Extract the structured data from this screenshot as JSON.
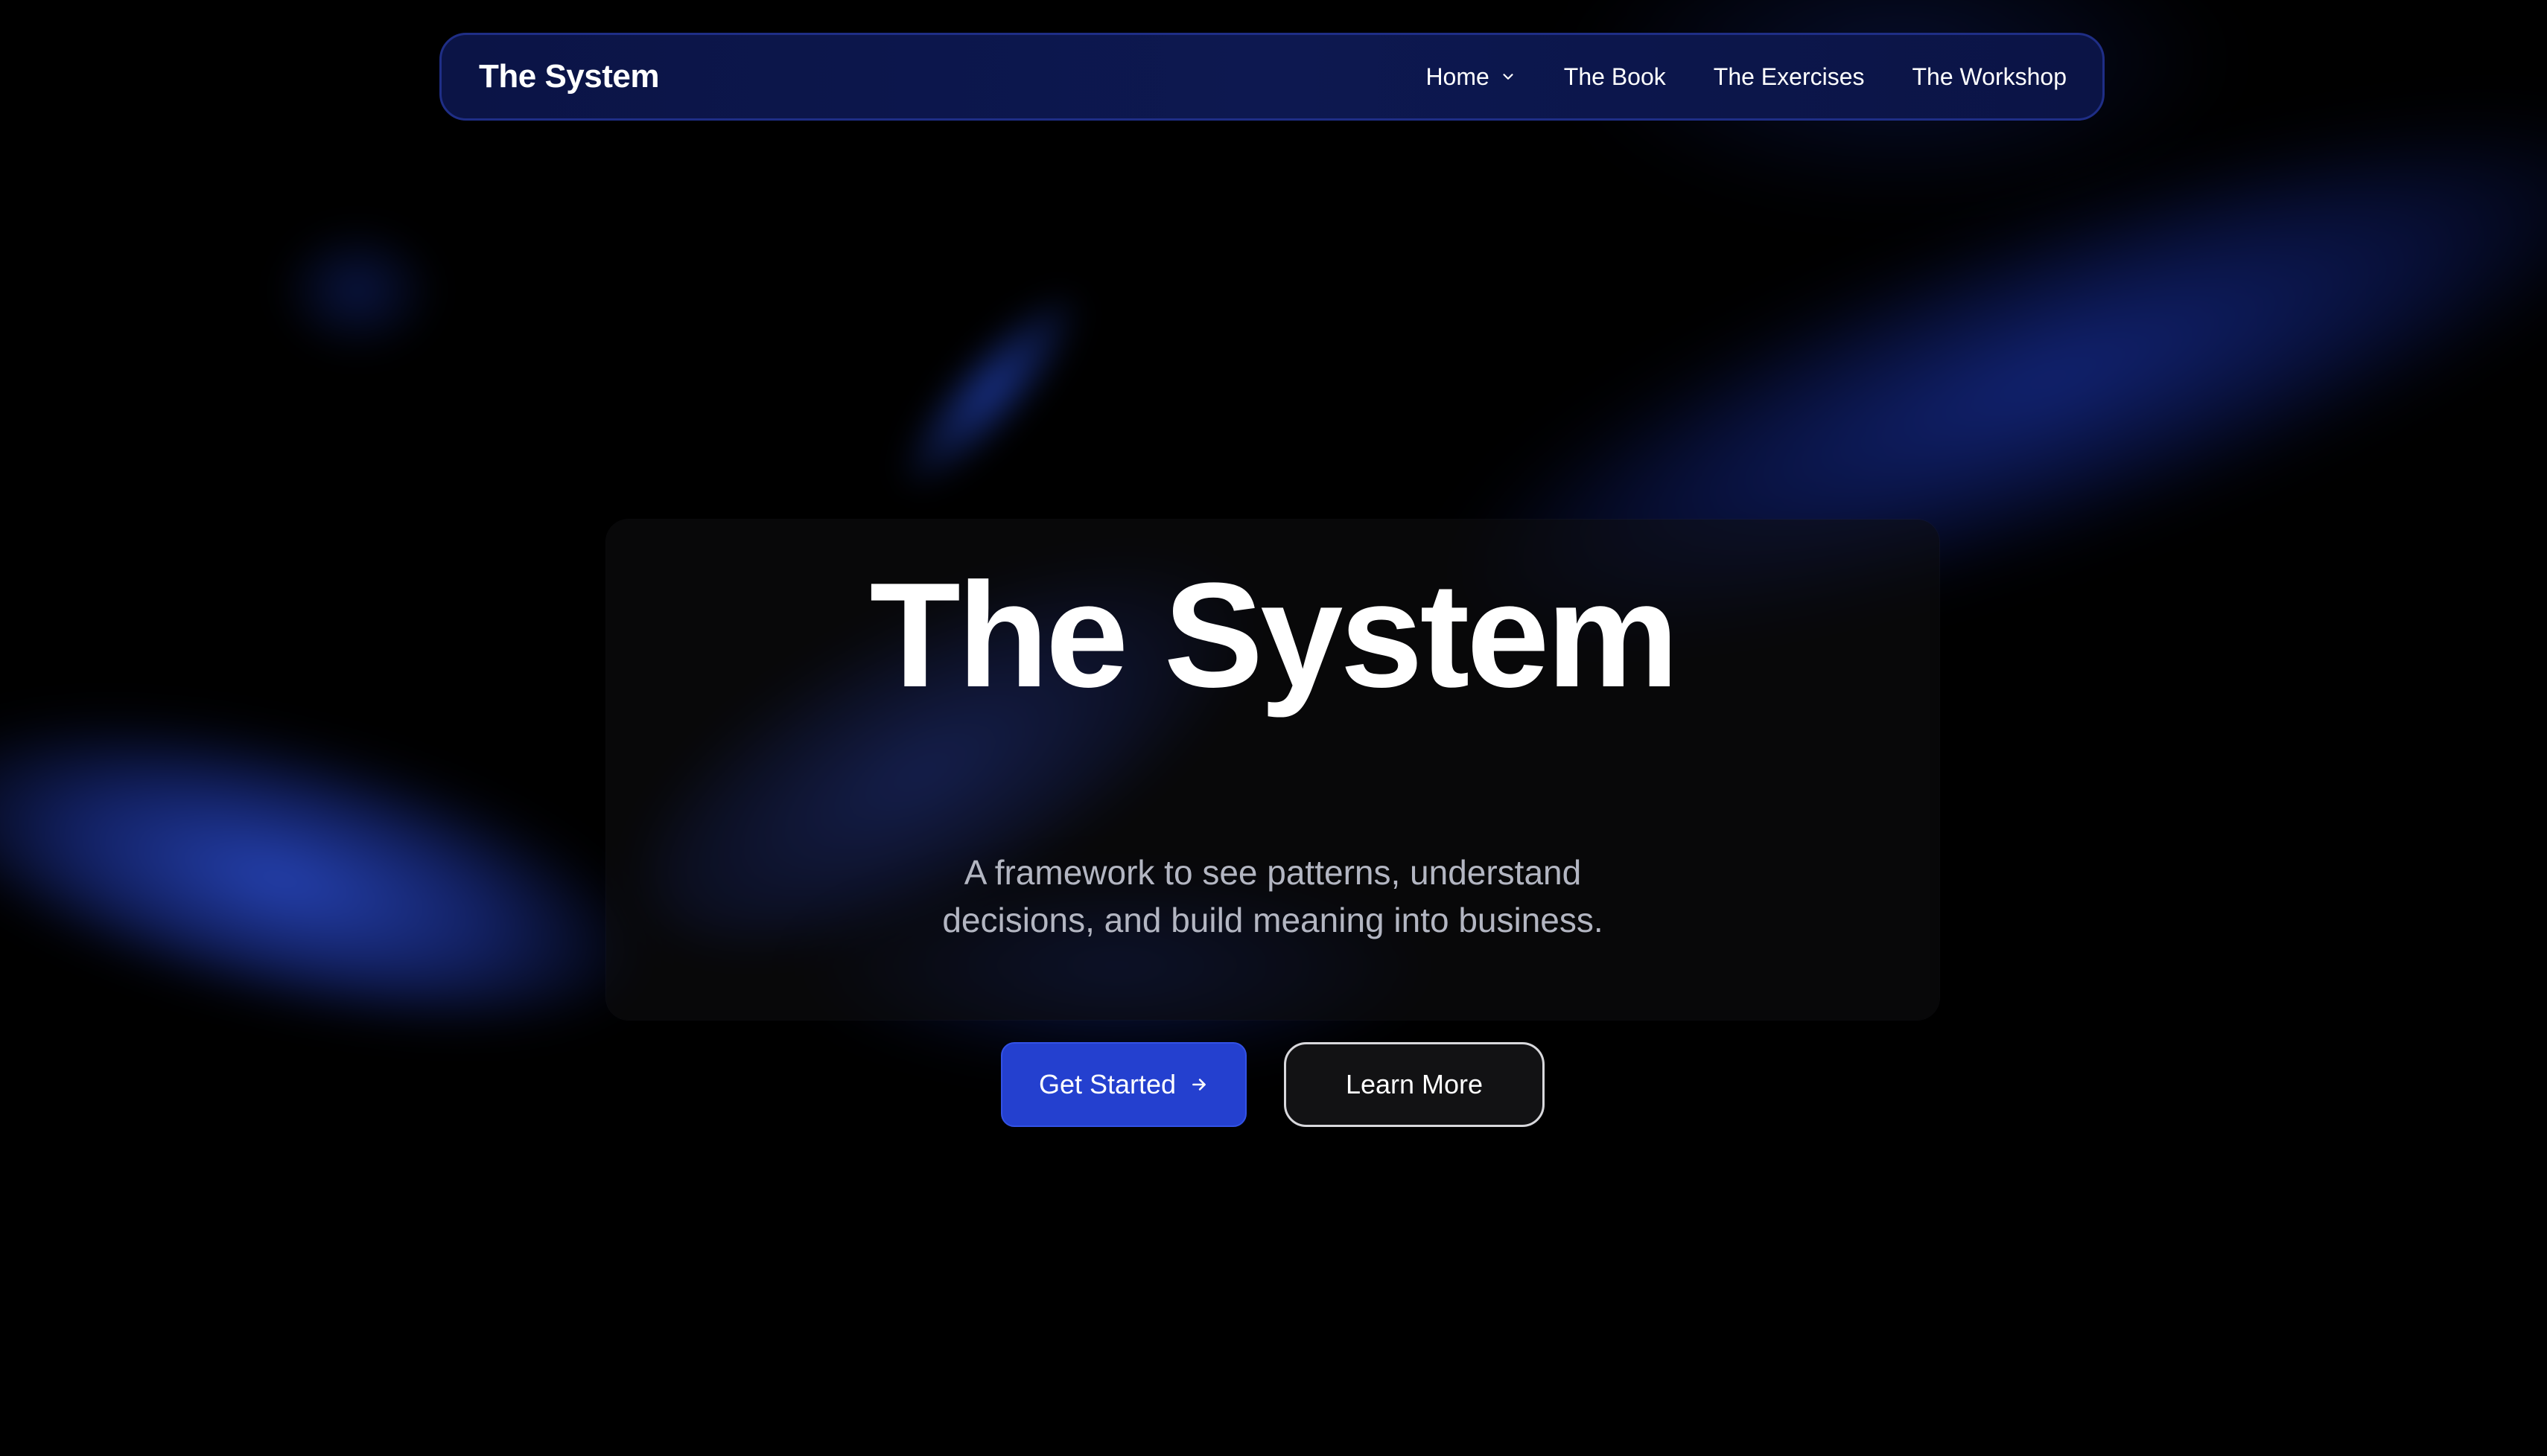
{
  "navbar": {
    "brand": "The System",
    "items": [
      {
        "label": "Home",
        "icon": "chevron-down-icon"
      },
      {
        "label": "The Book"
      },
      {
        "label": "The Exercises"
      },
      {
        "label": "The Workshop"
      }
    ]
  },
  "hero": {
    "title": "The System",
    "subtitle": "A framework to see patterns, understand decisions, and build meaning into business.",
    "primary_button": {
      "label": "Get Started",
      "icon": "arrow-right-icon"
    },
    "secondary_button": {
      "label": "Learn More"
    }
  },
  "colors": {
    "background": "#000000",
    "accent": "#2440cf",
    "nav_background": "#0c1648",
    "nav_border": "#1f2e86",
    "subtitle_text": "#b3b6c2"
  }
}
